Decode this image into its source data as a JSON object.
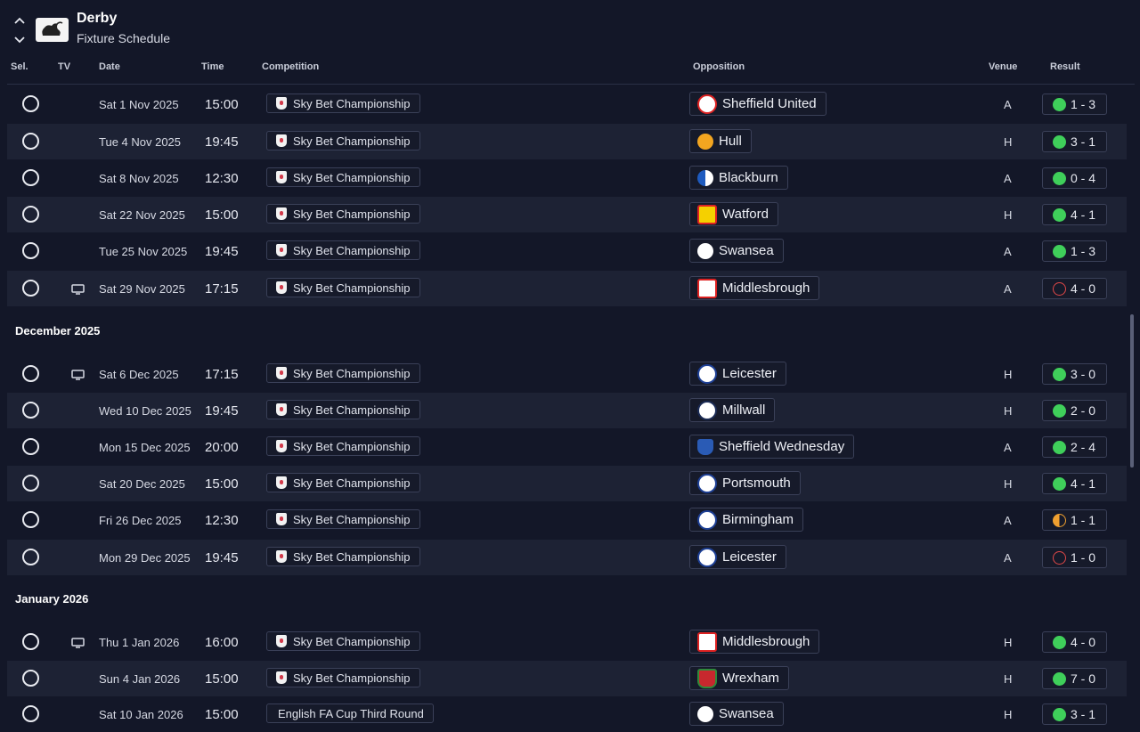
{
  "header": {
    "team_name": "Derby",
    "subtitle": "Fixture Schedule"
  },
  "columns": {
    "sel": "Sel.",
    "tv": "TV",
    "date": "Date",
    "time": "Time",
    "competition": "Competition",
    "opposition": "Opposition",
    "venue": "Venue",
    "result": "Result"
  },
  "months": {
    "december": "December 2025",
    "january": "January 2026"
  },
  "colors": {
    "background": "#131728",
    "row_alt": "#1d2234",
    "win": "#3fcf5a",
    "loss": "#e04848",
    "draw": "#f0a030"
  },
  "fixtures": [
    {
      "tv": false,
      "date": "Sat 1 Nov 2025",
      "time": "15:00",
      "competition": "Sky Bet Championship",
      "opposition": "Sheffield United",
      "venue": "A",
      "result": "1 - 3",
      "outcome": "win"
    },
    {
      "tv": false,
      "date": "Tue 4 Nov 2025",
      "time": "19:45",
      "competition": "Sky Bet Championship",
      "opposition": "Hull",
      "venue": "H",
      "result": "3 - 1",
      "outcome": "win"
    },
    {
      "tv": false,
      "date": "Sat 8 Nov 2025",
      "time": "12:30",
      "competition": "Sky Bet Championship",
      "opposition": "Blackburn",
      "venue": "A",
      "result": "0 - 4",
      "outcome": "win"
    },
    {
      "tv": false,
      "date": "Sat 22 Nov 2025",
      "time": "15:00",
      "competition": "Sky Bet Championship",
      "opposition": "Watford",
      "venue": "H",
      "result": "4 - 1",
      "outcome": "win"
    },
    {
      "tv": false,
      "date": "Tue 25 Nov 2025",
      "time": "19:45",
      "competition": "Sky Bet Championship",
      "opposition": "Swansea",
      "venue": "A",
      "result": "1 - 3",
      "outcome": "win"
    },
    {
      "tv": true,
      "date": "Sat 29 Nov 2025",
      "time": "17:15",
      "competition": "Sky Bet Championship",
      "opposition": "Middlesbrough",
      "venue": "A",
      "result": "4 - 0",
      "outcome": "loss"
    },
    {
      "tv": true,
      "date": "Sat 6 Dec 2025",
      "time": "17:15",
      "competition": "Sky Bet Championship",
      "opposition": "Leicester",
      "venue": "H",
      "result": "3 - 0",
      "outcome": "win"
    },
    {
      "tv": false,
      "date": "Wed 10 Dec 2025",
      "time": "19:45",
      "competition": "Sky Bet Championship",
      "opposition": "Millwall",
      "venue": "H",
      "result": "2 - 0",
      "outcome": "win"
    },
    {
      "tv": false,
      "date": "Mon 15 Dec 2025",
      "time": "20:00",
      "competition": "Sky Bet Championship",
      "opposition": "Sheffield Wednesday",
      "venue": "A",
      "result": "2 - 4",
      "outcome": "win"
    },
    {
      "tv": false,
      "date": "Sat 20 Dec 2025",
      "time": "15:00",
      "competition": "Sky Bet Championship",
      "opposition": "Portsmouth",
      "venue": "H",
      "result": "4 - 1",
      "outcome": "win"
    },
    {
      "tv": false,
      "date": "Fri 26 Dec 2025",
      "time": "12:30",
      "competition": "Sky Bet Championship",
      "opposition": "Birmingham",
      "venue": "A",
      "result": "1 - 1",
      "outcome": "draw"
    },
    {
      "tv": false,
      "date": "Mon 29 Dec 2025",
      "time": "19:45",
      "competition": "Sky Bet Championship",
      "opposition": "Leicester",
      "venue": "A",
      "result": "1 - 0",
      "outcome": "loss"
    },
    {
      "tv": true,
      "date": "Thu 1 Jan 2026",
      "time": "16:00",
      "competition": "Sky Bet Championship",
      "opposition": "Middlesbrough",
      "venue": "H",
      "result": "4 - 0",
      "outcome": "win"
    },
    {
      "tv": false,
      "date": "Sun 4 Jan 2026",
      "time": "15:00",
      "competition": "Sky Bet Championship",
      "opposition": "Wrexham",
      "venue": "H",
      "result": "7 - 0",
      "outcome": "win"
    },
    {
      "tv": false,
      "date": "Sat 10 Jan 2026",
      "time": "15:00",
      "competition": "English FA Cup Third Round",
      "opposition": "Swansea",
      "venue": "H",
      "result": "3 - 1",
      "outcome": "win"
    }
  ]
}
